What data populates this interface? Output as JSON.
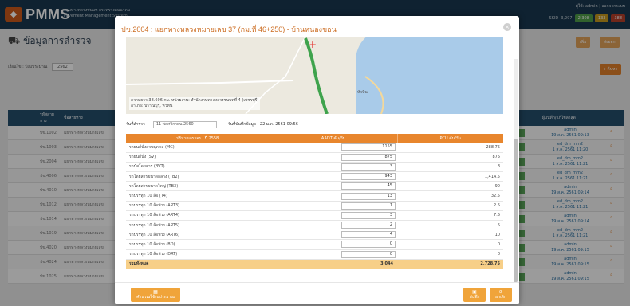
{
  "app": {
    "logo_text": "PMMS",
    "org_line1": "กรมทางหลวงชนบท กระทรวงคมนาคม",
    "org_line2": "Pavement Management System",
    "user": "ผู้ใช้: admin | ออกจากระบบ",
    "stats_label": "SKID",
    "stats_value": "3,297",
    "badges": [
      {
        "label": "2,308",
        "color": "#4f9e49"
      },
      {
        "label": "133",
        "color": "#c79a1e"
      },
      {
        "label": "388",
        "color": "#b5402b"
      }
    ]
  },
  "page": {
    "title": "ข้อมูลการสำรวจ",
    "filter_label": "เงื่อนไข : ปีงบประมาณ",
    "filter_value": "2562",
    "add_label": "เพิ่ม",
    "export_label": "ส่งออก",
    "search_label": "ค้นหา"
  },
  "bg_table": {
    "headers": [
      "รหัสสายทาง",
      "ชื่อสายทาง",
      "ผู้บันทึก/แก้ไขล่าสุด"
    ],
    "rows": [
      {
        "code": "ปข.1002",
        "name": "แยกทางหลวงหมายเลข",
        "user": "admin",
        "date": "19 ส.ค. 2561 09:13"
      },
      {
        "code": "ปข.1003",
        "name": "แยกทางหลวงหมายเลข",
        "user": "ed_dm_mm2",
        "date": "1 ส.ค. 2561 11:20"
      },
      {
        "code": "ปข.2004",
        "name": "แยกทางหลวงหมายเลข",
        "user": "ed_dm_mm2",
        "date": "1 ส.ค. 2561 11:21"
      },
      {
        "code": "ปข.4006",
        "name": "แยกทางหลวงหมายเลข",
        "user": "ed_dm_mm2",
        "date": "1 ส.ค. 2561 11:21"
      },
      {
        "code": "ปข.4010",
        "name": "แยกทางหลวงหมายเลข",
        "user": "admin",
        "date": "19 ส.ค. 2561 09:14"
      },
      {
        "code": "ปข.1012",
        "name": "แยกทางหลวงหมายเลข",
        "user": "ed_dm_mm2",
        "date": "1 ส.ค. 2561 11:21"
      },
      {
        "code": "ปข.1014",
        "name": "แยกทางหลวงหมายเลข",
        "user": "admin",
        "date": "19 ส.ค. 2561 09:14"
      },
      {
        "code": "ปข.1019",
        "name": "แยกทางหลวงหมายเลข",
        "user": "ed_dm_mm2",
        "date": "1 ส.ค. 2561 11:21"
      },
      {
        "code": "ปข.4020",
        "name": "แยกทางหลวงหมายเลข",
        "user": "admin",
        "date": "19 ส.ค. 2561 09:15"
      },
      {
        "code": "ปข.4024",
        "name": "แยกทางหลวงหมายเลข",
        "user": "admin",
        "date": "19 ส.ค. 2561 09:15"
      },
      {
        "code": "ปข.1025",
        "name": "แยกทางหลวงหมายเลข",
        "user": "admin",
        "date": "19 ส.ค. 2561 09:15"
      }
    ]
  },
  "modal": {
    "title": "ปข.2004 : แยกทางหลวงหมายเลข 37 (กม.ที่ 46+250) - บ้านหนองขอน",
    "map_caption_1": "ความยาว 38.606 กม. หน่วยงาน: สำนักงานทางหลวงชนบทที่ 4 (เพชรบุรี)",
    "map_caption_2": "อำเภอ: ปราณบุรี, หัวหิน",
    "map_place": "หัวหิน",
    "survey_date_label": "วันที่สำรวจ",
    "survey_date_value": "11 พฤศจิกายน 2560",
    "record_label": "วันที่บันทึกข้อมูล : 22 ม.ค. 2561 09:56",
    "col_vehicle": "ปริมาณจราจร : ปี 2558",
    "col_aadt": "AADT คัน/วัน",
    "col_pcu": "PCU คัน/วัน",
    "rows": [
      {
        "label": "รถยนต์นั่งส่วนบุคคล (MC)",
        "aadt": "1155",
        "pcu": "288.75"
      },
      {
        "label": "รถยนต์นั่ง (SV)",
        "aadt": "875",
        "pcu": "875"
      },
      {
        "label": "รถบัสโดยสาร (BVT)",
        "aadt": "3",
        "pcu": "3"
      },
      {
        "label": "รถโดยสารขนาดกลาง (TB2)",
        "aadt": "943",
        "pcu": "1,414.5"
      },
      {
        "label": "รถโดยสารขนาดใหญ่ (TB3)",
        "aadt": "45",
        "pcu": "90"
      },
      {
        "label": "รถบรรทุก 10 ล้อ (T4)",
        "aadt": "13",
        "pcu": "32.5"
      },
      {
        "label": "รถบรรทุก 10 ล้อพ่วง (ART3)",
        "aadt": "1",
        "pcu": "2.5"
      },
      {
        "label": "รถบรรทุก 10 ล้อพ่วง (ART4)",
        "aadt": "3",
        "pcu": "7.5"
      },
      {
        "label": "รถบรรทุก 10 ล้อพ่วง (ART5)",
        "aadt": "2",
        "pcu": "5"
      },
      {
        "label": "รถบรรทุก 10 ล้อพ่วง (ART6)",
        "aadt": "4",
        "pcu": "10"
      },
      {
        "label": "รถบรรทุก 10 ล้อพ่วง (BD)",
        "aadt": "0",
        "pcu": "0"
      },
      {
        "label": "รถบรรทุก 10 ล้อพ่วง (DRT)",
        "aadt": "0",
        "pcu": "0"
      }
    ],
    "total_label": "รวมทั้งหมด",
    "total_aadt": "3,044",
    "total_pcu": "2,728.75",
    "calc_button": "คำนวณใช้งบประมาณ",
    "save_button": "บันทึก",
    "cancel_button": "ยกเลิก"
  }
}
